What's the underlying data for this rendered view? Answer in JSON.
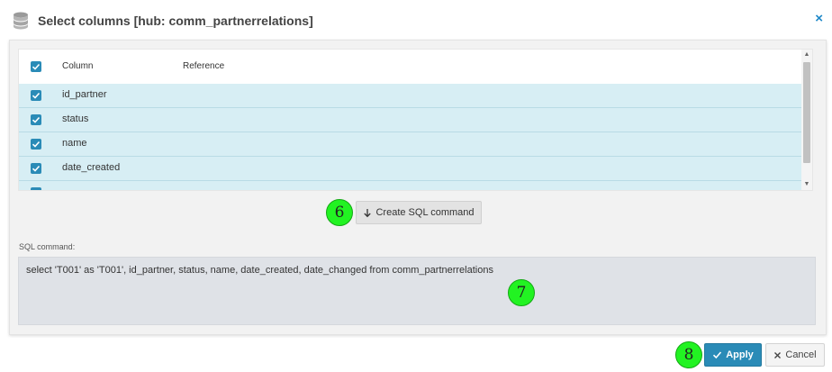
{
  "dialog": {
    "title": "Select columns [hub: comm_partnerrelations]",
    "close_glyph": "×"
  },
  "grid": {
    "headers": {
      "column": "Column",
      "reference": "Reference"
    },
    "rows": [
      {
        "column": "id_partner",
        "reference": "",
        "checked": true
      },
      {
        "column": "status",
        "reference": "",
        "checked": true
      },
      {
        "column": "name",
        "reference": "",
        "checked": true
      },
      {
        "column": "date_created",
        "reference": "",
        "checked": true
      }
    ]
  },
  "create_sql_button": {
    "label": "Create SQL command",
    "icon": "arrow-down-icon"
  },
  "sql": {
    "label": "SQL command:",
    "value": "select 'T001' as 'T001', id_partner, status, name, date_created, date_changed from comm_partnerrelations"
  },
  "footer": {
    "apply_label": "Apply",
    "cancel_label": "Cancel"
  },
  "markers": {
    "m6": "6",
    "m7": "7",
    "m8": "8"
  },
  "colors": {
    "accent": "#2a8bb7",
    "row_selected": "#d7eef4",
    "marker": "#22f322"
  }
}
